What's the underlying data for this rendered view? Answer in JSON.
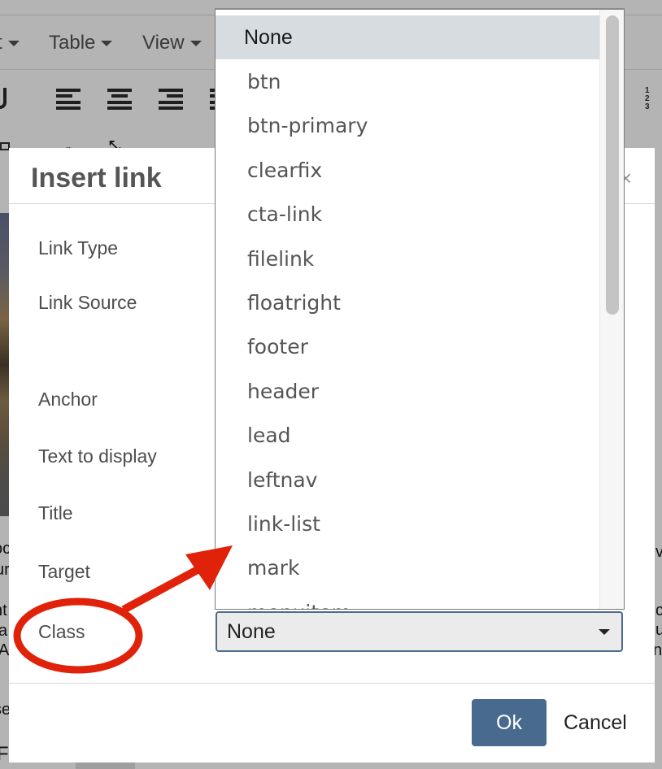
{
  "editor": {
    "menubar": [
      {
        "label": "t"
      },
      {
        "label": "Table"
      },
      {
        "label": "View"
      }
    ],
    "background_text": [
      "oc",
      "ur",
      "nt",
      "a",
      "A",
      "se",
      "Fe",
      "v",
      "c",
      "u",
      "nt"
    ]
  },
  "dialog": {
    "title": "Insert link",
    "close_symbol": "×",
    "fields": [
      {
        "label": "Link Type"
      },
      {
        "label": "Link Source"
      },
      {
        "label": "Anchor"
      },
      {
        "label": "Text to display"
      },
      {
        "label": "Title"
      },
      {
        "label": "Target"
      },
      {
        "label": "Class"
      }
    ],
    "class_select": {
      "value": "None",
      "options": [
        "None",
        "btn",
        "btn-primary",
        "clearfix",
        "cta-link",
        "filelink",
        "floatright",
        "footer",
        "header",
        "lead",
        "leftnav",
        "link-list",
        "mark",
        "menuitem"
      ],
      "highlighted": "None"
    },
    "buttons": {
      "ok": "Ok",
      "cancel": "Cancel"
    }
  },
  "annotation": {
    "color": "#e0220a",
    "circled_label": "Class",
    "arrow_target": "class-dropdown-list"
  }
}
